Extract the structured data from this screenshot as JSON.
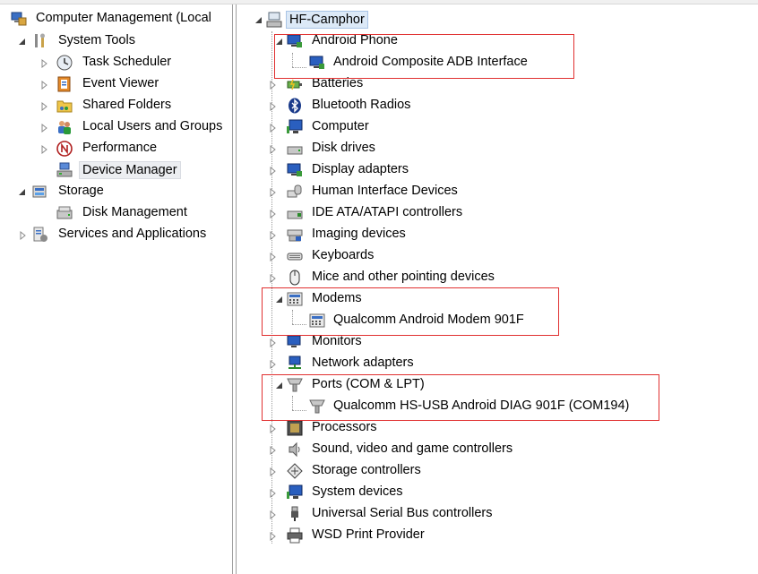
{
  "left_tree": {
    "root_label": "Computer Management (Local",
    "system_tools": "System Tools",
    "task_scheduler": "Task Scheduler",
    "event_viewer": "Event Viewer",
    "shared_folders": "Shared Folders",
    "local_users": "Local Users and Groups",
    "performance": "Performance",
    "device_manager": "Device Manager",
    "storage": "Storage",
    "disk_management": "Disk Management",
    "services_apps": "Services and Applications"
  },
  "device_tree": {
    "root": "HF-Camphor",
    "android_phone": "Android Phone",
    "adb_interface": "Android Composite ADB Interface",
    "batteries": "Batteries",
    "bluetooth": "Bluetooth Radios",
    "computer": "Computer",
    "disk_drives": "Disk drives",
    "display_adapters": "Display adapters",
    "hid": "Human Interface Devices",
    "ide": "IDE ATA/ATAPI controllers",
    "imaging": "Imaging devices",
    "keyboards": "Keyboards",
    "mice": "Mice and other pointing devices",
    "modems": "Modems",
    "modem_device": "Qualcomm Android Modem 901F",
    "monitors": "Monitors",
    "network": "Network adapters",
    "ports": "Ports (COM & LPT)",
    "port_device": "Qualcomm HS-USB Android DIAG 901F (COM194)",
    "processors": "Processors",
    "sound": "Sound, video and game controllers",
    "storage_controllers": "Storage controllers",
    "system_devices": "System devices",
    "usb": "Universal Serial Bus controllers",
    "wsd": "WSD Print Provider"
  },
  "highlight_color": "#e03030",
  "icons": [
    "computer-management-icon",
    "tools-icon",
    "clock-icon",
    "event-log-icon",
    "shared-folder-icon",
    "users-icon",
    "performance-icon",
    "device-manager-icon",
    "storage-icon",
    "disk-icon",
    "services-icon",
    "phone-icon",
    "monitor-icon",
    "battery-icon",
    "bluetooth-icon",
    "drive-icon",
    "hid-icon",
    "ide-icon",
    "camera-icon",
    "keyboard-icon",
    "mouse-icon",
    "modem-icon",
    "network-icon",
    "port-icon",
    "processor-icon",
    "sound-icon",
    "storage-controller-icon",
    "usb-icon",
    "printer-icon"
  ]
}
